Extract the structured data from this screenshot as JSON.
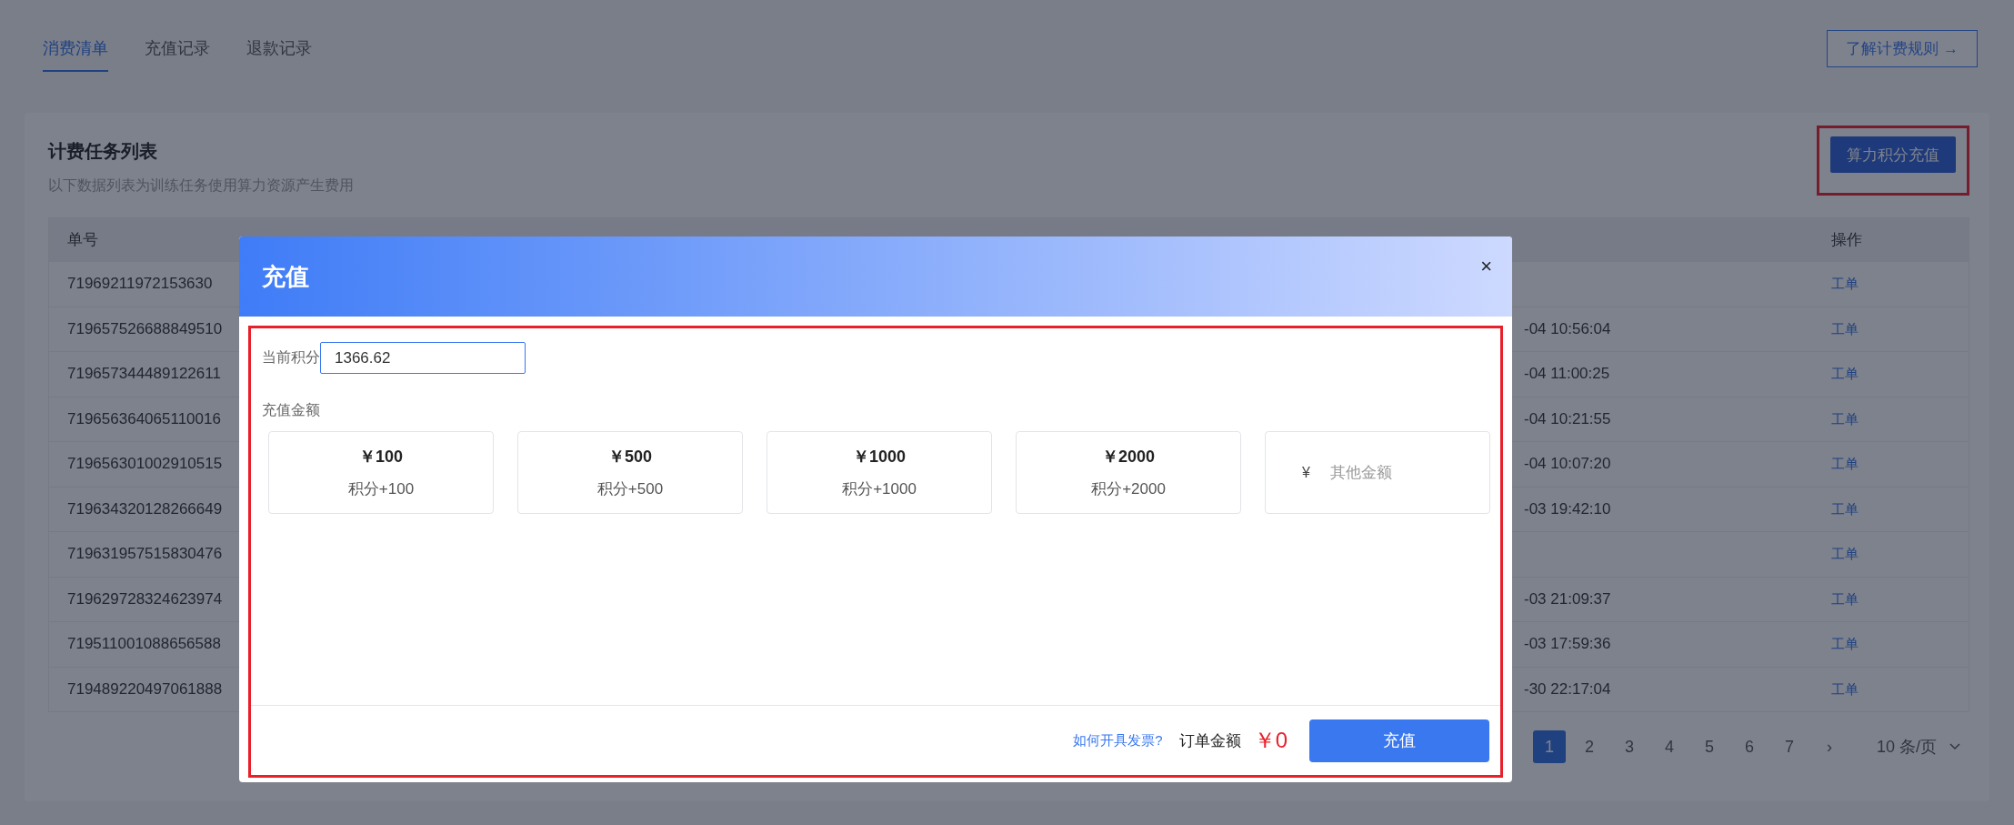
{
  "tabs": [
    {
      "label": "消费清单",
      "selected": true
    },
    {
      "label": "充值记录",
      "selected": false
    },
    {
      "label": "退款记录",
      "selected": false
    }
  ],
  "rules_link": {
    "label": "了解计费规则",
    "arrow": "→"
  },
  "card": {
    "title": "计费任务列表",
    "subtitle": "以下数据列表为训练任务使用算力资源产生费用",
    "recharge_button": {
      "label": "算力积分充值",
      "highlighted": true
    }
  },
  "table": {
    "columns": [
      "单号",
      "操作"
    ],
    "rows": [
      {
        "id": "71969211972153630",
        "end_time": "",
        "action": "工单"
      },
      {
        "id": "719657526688849510",
        "end_time": "-04 10:56:04",
        "action": "工单"
      },
      {
        "id": "719657344489122611",
        "end_time": "-04 11:00:25",
        "action": "工单"
      },
      {
        "id": "719656364065110016",
        "end_time": "-04 10:21:55",
        "action": "工单"
      },
      {
        "id": "719656301002910515",
        "end_time": "-04 10:07:20",
        "action": "工单"
      },
      {
        "id": "719634320128266649",
        "end_time": "-03 19:42:10",
        "action": "工单"
      },
      {
        "id": "719631957515830476",
        "end_time": "",
        "action": "工单"
      },
      {
        "id": "719629728324623974",
        "end_time": "-03 21:09:37",
        "action": "工单"
      },
      {
        "id": "719511001088656588",
        "end_time": "-03 17:59:36",
        "action": "工单"
      },
      {
        "id": "719489220497061888",
        "end_time": "-30 22:17:04",
        "action": "工单"
      }
    ]
  },
  "pagination": {
    "pages": [
      {
        "label": "1",
        "selected": true
      },
      {
        "label": "2",
        "selected": false
      },
      {
        "label": "3",
        "selected": false
      },
      {
        "label": "4",
        "selected": false
      },
      {
        "label": "5",
        "selected": false
      },
      {
        "label": "6",
        "selected": false
      },
      {
        "label": "7",
        "selected": false
      }
    ],
    "next": "›",
    "page_size": "10 条/页"
  },
  "dialog": {
    "title": "充值",
    "close": "×",
    "highlighted": true,
    "balance_label": "当前积分",
    "balance_value": "1366.62",
    "amount_label": "充值金额",
    "options": [
      {
        "kind": "preset",
        "price": "￥100",
        "points": "积分+100",
        "selected": false
      },
      {
        "kind": "preset",
        "price": "￥500",
        "points": "积分+500",
        "selected": false
      },
      {
        "kind": "preset",
        "price": "￥1000",
        "points": "积分+1000",
        "selected": false
      },
      {
        "kind": "preset",
        "price": "￥2000",
        "points": "积分+2000",
        "selected": false
      },
      {
        "kind": "custom",
        "currency": "¥",
        "placeholder": "其他金额",
        "selected": false
      }
    ],
    "invoice_link": "如何开具发票?",
    "total_label": "订单金额",
    "total_value": "￥0",
    "submit": "充值"
  }
}
